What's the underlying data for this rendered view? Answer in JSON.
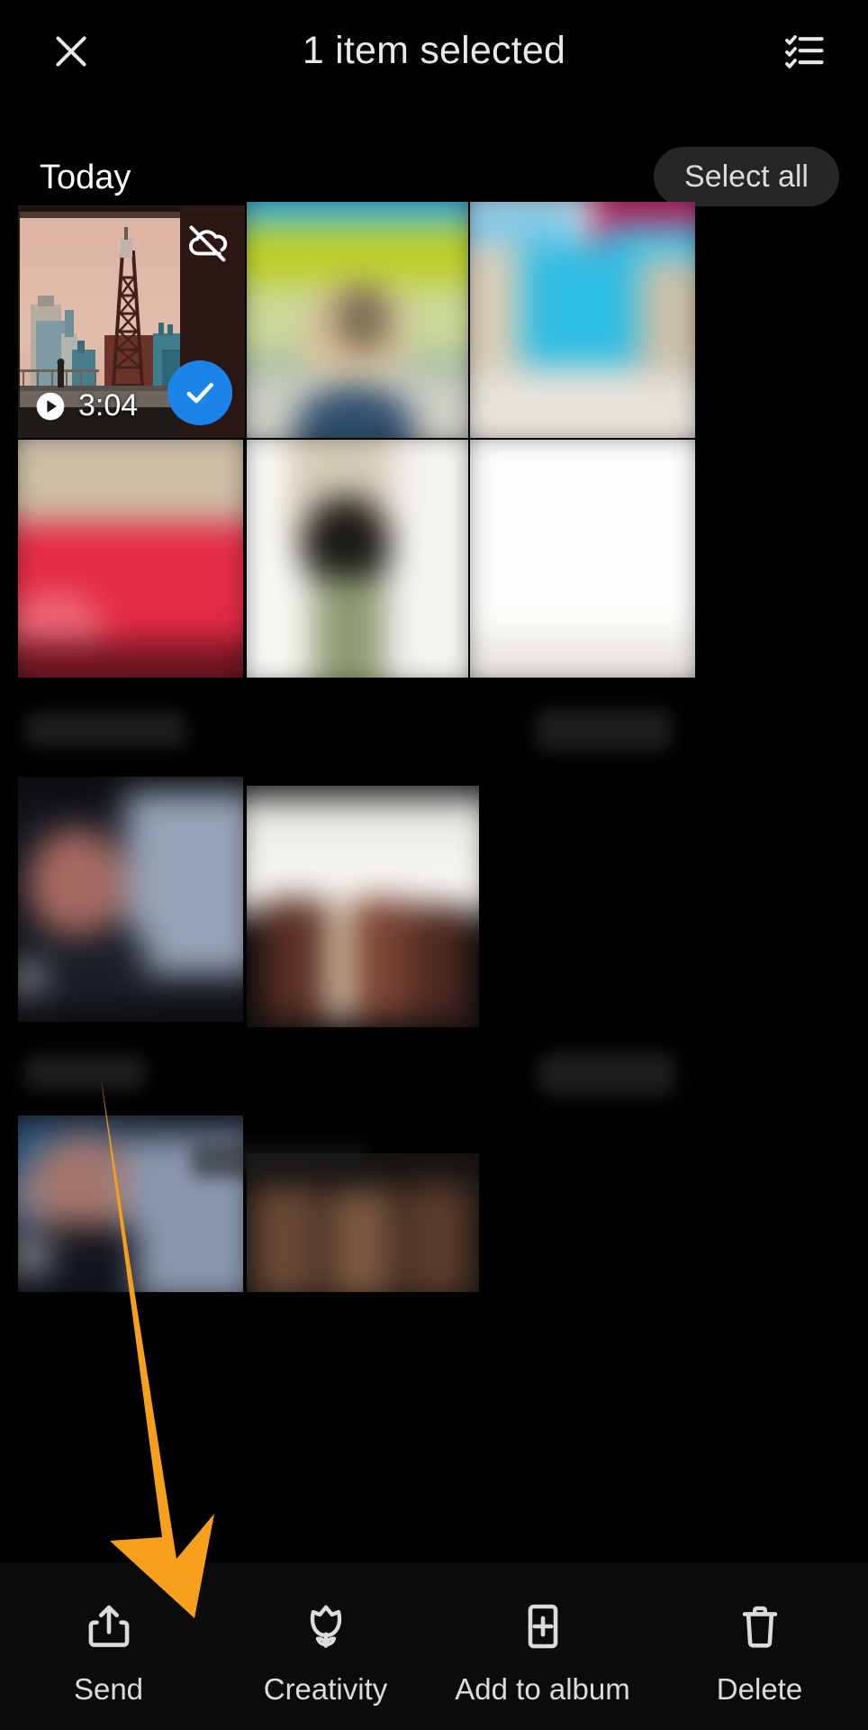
{
  "topbar": {
    "close_icon": "close-icon",
    "title": "1 item selected",
    "list_icon": "checklist-icon"
  },
  "section": {
    "title": "Today",
    "select_all_label": "Select all"
  },
  "selected_item": {
    "duration": "3:04",
    "cloud_icon": "cloud-off-icon",
    "play_icon": "play-icon",
    "check_icon": "check-icon",
    "selected": true
  },
  "bottombar": {
    "actions": [
      {
        "icon": "send-icon",
        "label": "Send"
      },
      {
        "icon": "creativity-icon",
        "label": "Creativity"
      },
      {
        "icon": "add-to-album-icon",
        "label": "Add to album"
      },
      {
        "icon": "delete-icon",
        "label": "Delete"
      }
    ]
  },
  "annotation": {
    "arrow_color": "#F8A01C",
    "arrow_target": "Send"
  },
  "colors": {
    "background": "#000000",
    "accent_blue": "#1A84E8",
    "chip_background": "#262626",
    "bottombar_background": "#0B0B0B",
    "text_primary": "#FFFFFF",
    "text_secondary": "#DCDCDC"
  }
}
